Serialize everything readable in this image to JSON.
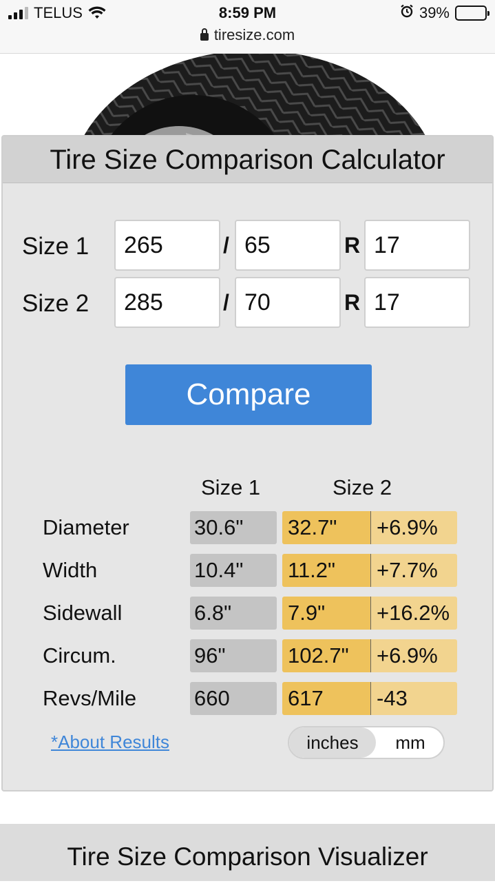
{
  "status": {
    "carrier": "TELUS",
    "time": "8:59 PM",
    "battery": "39%",
    "battery_level": 0.39,
    "url": "tiresize.com"
  },
  "calculator": {
    "title": "Tire Size Comparison Calculator",
    "size1": {
      "label": "Size 1",
      "width": "265",
      "ratio": "65",
      "rim": "17"
    },
    "size2": {
      "label": "Size 2",
      "width": "285",
      "ratio": "70",
      "rim": "17"
    },
    "slash": "/",
    "r": "R",
    "compare_label": "Compare"
  },
  "results": {
    "col_size1": "Size 1",
    "col_size2": "Size 2",
    "rows": [
      {
        "label": "Diameter",
        "s1": "30.6\"",
        "s2": "32.7\"",
        "diff": "+6.9%"
      },
      {
        "label": "Width",
        "s1": "10.4\"",
        "s2": "11.2\"",
        "diff": "+7.7%"
      },
      {
        "label": "Sidewall",
        "s1": "6.8\"",
        "s2": "7.9\"",
        "diff": "+16.2%"
      },
      {
        "label": "Circum.",
        "s1": "96\"",
        "s2": "102.7\"",
        "diff": "+6.9%"
      },
      {
        "label": "Revs/Mile",
        "s1": "660",
        "s2": "617",
        "diff": "-43"
      }
    ],
    "about_link": "*About Results",
    "unit_inches": "inches",
    "unit_mm": "mm"
  },
  "visualizer": {
    "title": "Tire Size Comparison Visualizer"
  },
  "colors": {
    "accent": "#3f86d8",
    "size2_cell": "#eec25c",
    "diff_cell": "#f2d48f",
    "size1_cell": "#c4c4c4"
  }
}
